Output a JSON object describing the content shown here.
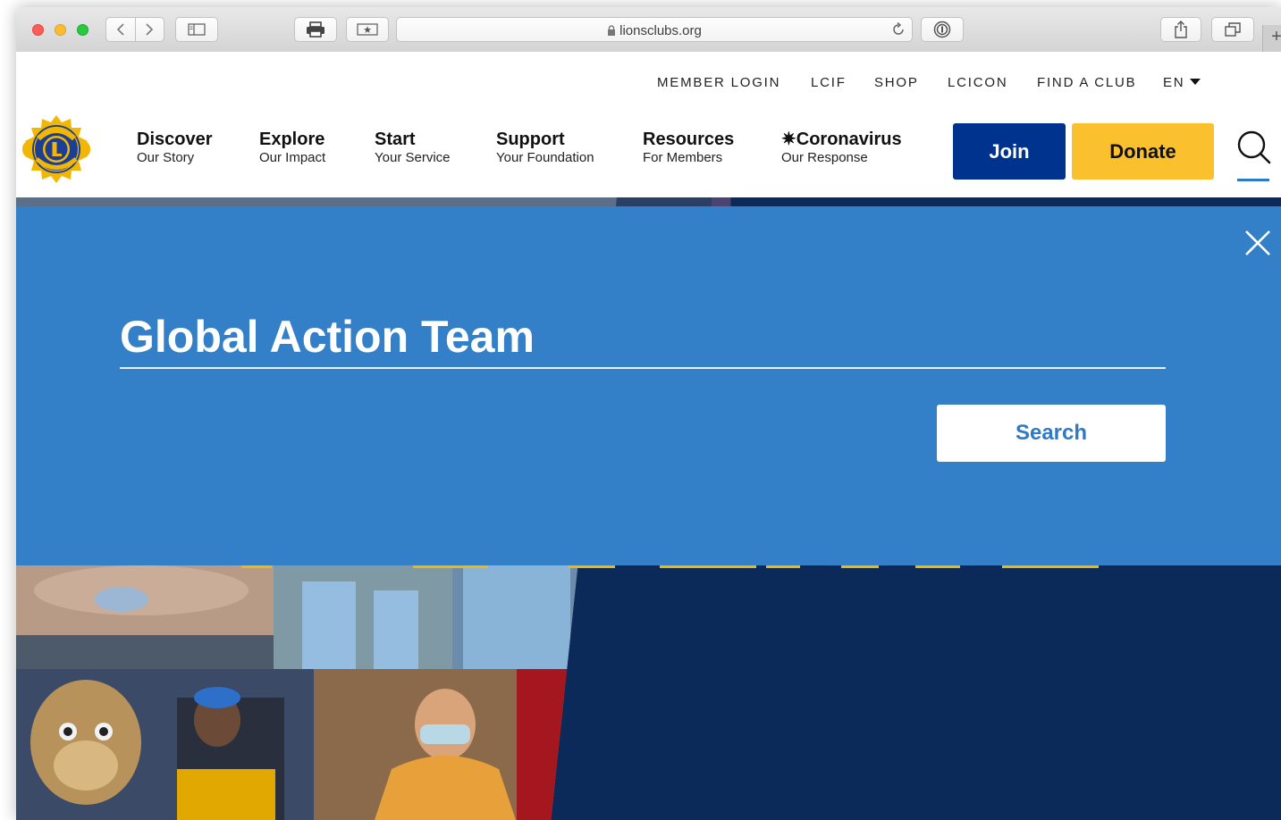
{
  "browser": {
    "url": "lionsclubs.org"
  },
  "utility_nav": [
    {
      "label": "MEMBER LOGIN"
    },
    {
      "label": "LCIF"
    },
    {
      "label": "SHOP"
    },
    {
      "label": "LCICON"
    },
    {
      "label": "FIND A CLUB"
    },
    {
      "label": "EN"
    }
  ],
  "main_nav": [
    {
      "title": "Discover",
      "subtitle": "Our Story"
    },
    {
      "title": "Explore",
      "subtitle": "Our Impact"
    },
    {
      "title": "Start",
      "subtitle": "Your Service"
    },
    {
      "title": "Support",
      "subtitle": "Your Foundation"
    },
    {
      "title": "Resources",
      "subtitle": "For Members"
    },
    {
      "title": "✷Coronavirus",
      "subtitle": "Our Response"
    }
  ],
  "header_buttons": {
    "join": "Join",
    "donate": "Donate"
  },
  "search_overlay": {
    "query": "Global Action Team",
    "submit_label": "Search"
  },
  "colors": {
    "overlay_blue": "#3480c8",
    "join_navy": "#00338d",
    "donate_yellow": "#fbc02d",
    "hero_navy": "#0b2a59"
  },
  "icons": [
    "back-icon",
    "forward-icon",
    "sidebar-icon",
    "print-icon",
    "bookmark-icon",
    "lock-icon",
    "reload-icon",
    "password-icon",
    "share-icon",
    "tabs-icon",
    "search-icon",
    "close-icon",
    "chevron-down-icon"
  ]
}
